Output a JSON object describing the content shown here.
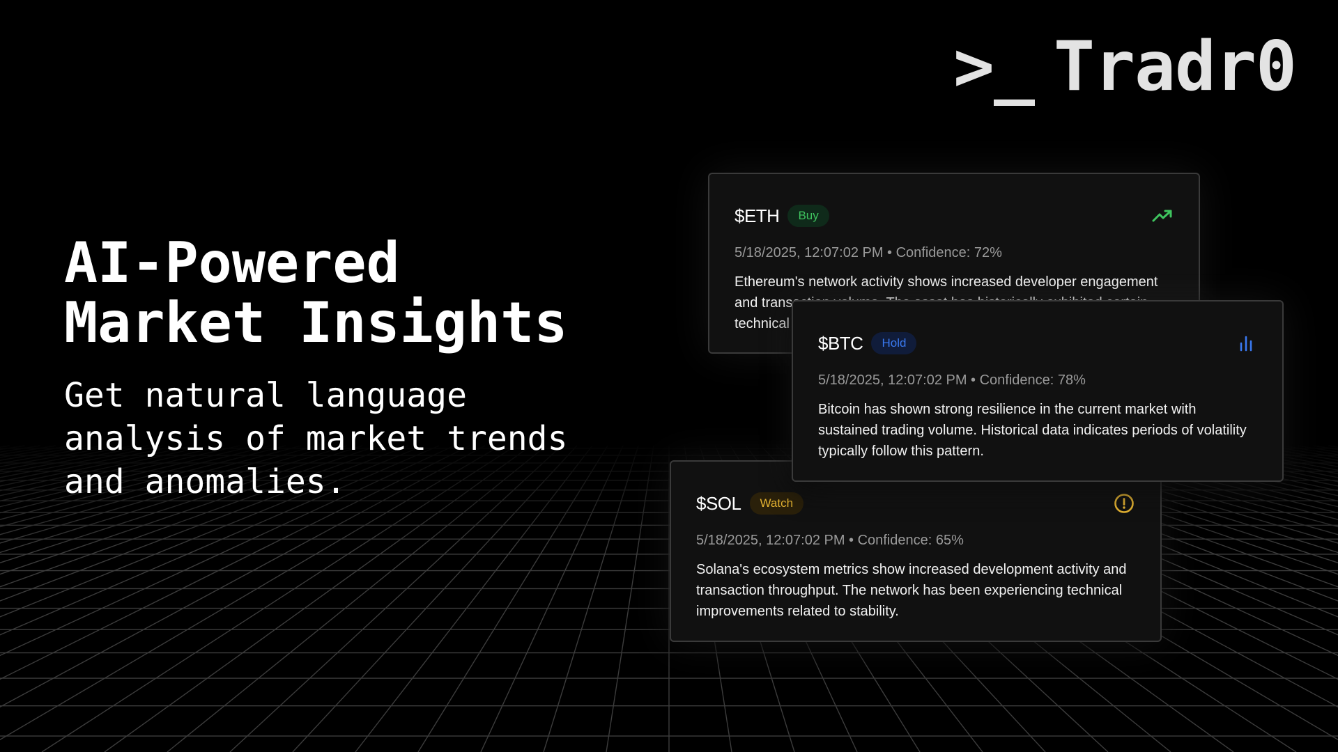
{
  "brand": {
    "prompt": ">_",
    "name": "Tradr0"
  },
  "hero": {
    "title": "AI-Powered\nMarket Insights",
    "subtitle": "Get natural language\nanalysis of market trends\nand anomalies."
  },
  "colors": {
    "background": "#000000",
    "buy": "#3fc45f",
    "hold": "#3a79f0",
    "watch": "#e6b432"
  },
  "cards": [
    {
      "ticker": "$ETH",
      "signal": "Buy",
      "icon": "trending-up-icon",
      "meta": "5/18/2025, 12:07:02 PM • Confidence: 72%",
      "description": "Ethereum's network activity shows increased developer engagement and transaction volume. The asset has historically exhibited certain technical"
    },
    {
      "ticker": "$BTC",
      "signal": "Hold",
      "icon": "bar-chart-icon",
      "meta": "5/18/2025, 12:07:02 PM • Confidence: 78%",
      "description": "Bitcoin has shown strong resilience in the current market with sustained trading volume. Historical data indicates periods of volatility typically follow this pattern."
    },
    {
      "ticker": "$SOL",
      "signal": "Watch",
      "icon": "alert-circle-icon",
      "meta": "5/18/2025, 12:07:02 PM • Confidence: 65%",
      "description": "Solana's ecosystem metrics show increased development activity and transaction throughput. The network has been experiencing technical improvements related to stability."
    }
  ]
}
